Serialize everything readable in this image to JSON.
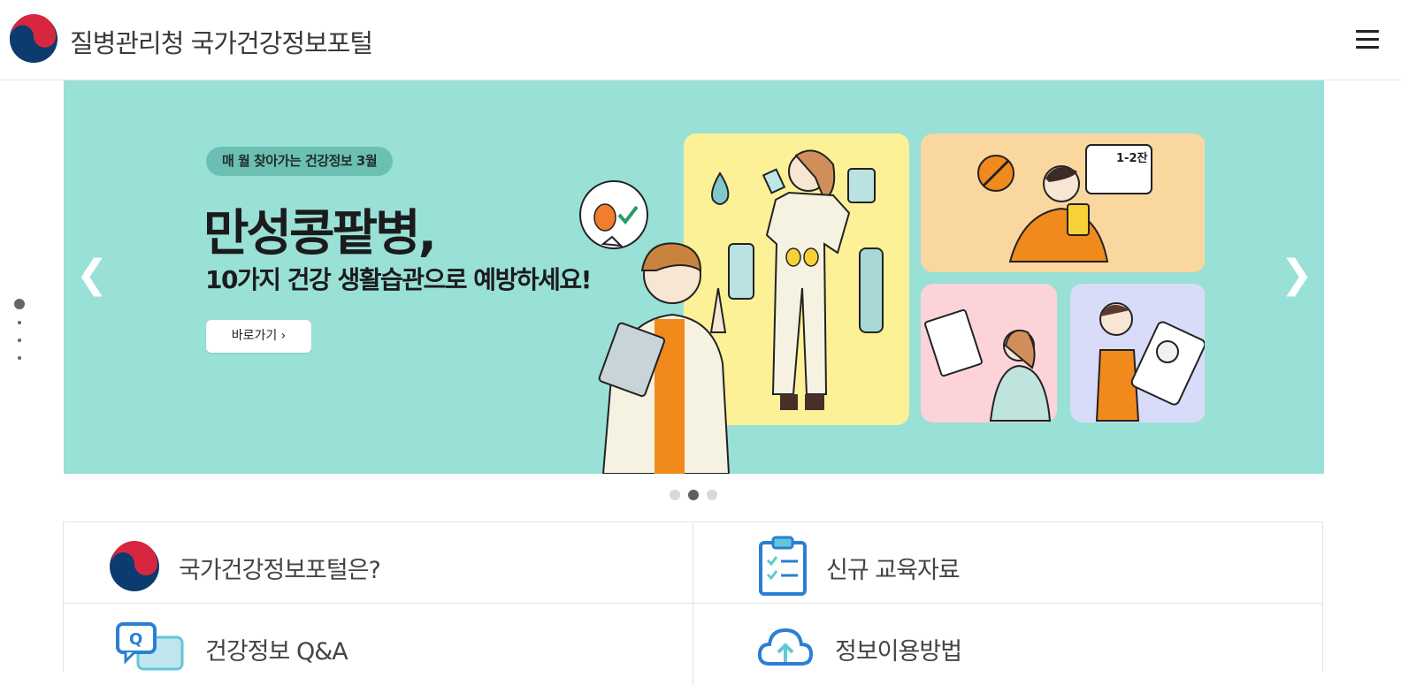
{
  "header": {
    "title": "질병관리청 국가건강정보포털",
    "logo_icon": "government-taegeuk-logo",
    "menu_icon": "hamburger-menu-icon"
  },
  "banner": {
    "badge": "매 월 찾아가는 건강정보 3월",
    "title": "만성콩팥병,",
    "subtitle": "10가지 건강 생활습관으로 예방하세요!",
    "button_label": "바로가기 ›",
    "prev_icon": "chevron-left-icon",
    "next_icon": "chevron-right-icon",
    "illustration_text": "1-2잔",
    "background_color": "#99e0d7"
  },
  "carousel": {
    "slide_count": 3,
    "active_index": 1
  },
  "side_pager": {
    "count": 4,
    "active_index": 0
  },
  "quick_links": [
    {
      "label": "국가건강정보포털은?",
      "icon": "taegeuk-logo-icon"
    },
    {
      "label": "신규 교육자료",
      "icon": "clipboard-checklist-icon"
    },
    {
      "label": "건강정보 Q&A",
      "icon": "qa-chat-icon"
    },
    {
      "label": "정보이용방법",
      "icon": "cloud-upload-icon"
    }
  ]
}
